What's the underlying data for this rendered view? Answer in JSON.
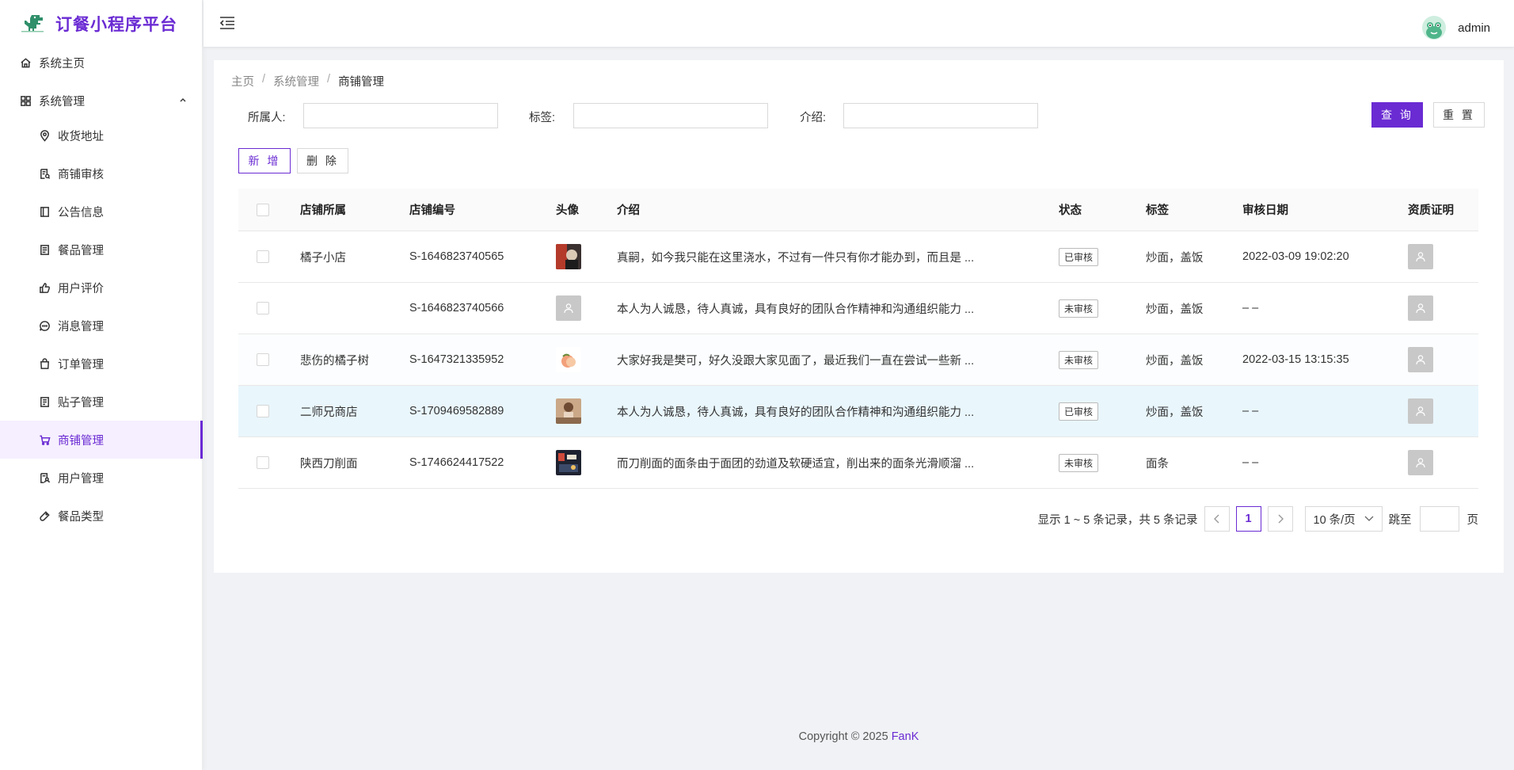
{
  "app": {
    "title": "订餐小程序平台"
  },
  "header": {
    "username": "admin"
  },
  "sidebar": {
    "items": [
      {
        "label": "系统主页",
        "icon": "home-icon"
      },
      {
        "label": "系统管理",
        "icon": "grid-icon"
      },
      {
        "label": "收货地址",
        "icon": "location-icon"
      },
      {
        "label": "商铺审核",
        "icon": "audit-icon"
      },
      {
        "label": "公告信息",
        "icon": "notice-icon"
      },
      {
        "label": "餐品管理",
        "icon": "dish-icon"
      },
      {
        "label": "用户评价",
        "icon": "thumb-up-icon"
      },
      {
        "label": "消息管理",
        "icon": "message-icon"
      },
      {
        "label": "订单管理",
        "icon": "bag-icon"
      },
      {
        "label": "贴子管理",
        "icon": "post-icon"
      },
      {
        "label": "商铺管理",
        "icon": "cart-icon"
      },
      {
        "label": "用户管理",
        "icon": "user-doc-icon"
      },
      {
        "label": "餐品类型",
        "icon": "tag-icon"
      }
    ],
    "active": "商铺管理"
  },
  "breadcrumb": [
    "主页",
    "系统管理",
    "商铺管理"
  ],
  "filters": {
    "owner_label": "所属人:",
    "owner_value": "",
    "tag_label": "标签:",
    "tag_value": "",
    "intro_label": "介绍:",
    "intro_value": ""
  },
  "buttons": {
    "query": "查 询",
    "reset": "重 置",
    "add": "新 增",
    "delete": "删 除"
  },
  "table": {
    "columns": [
      "店铺所属",
      "店铺编号",
      "头像",
      "介绍",
      "状态",
      "标签",
      "审核日期",
      "资质证明"
    ],
    "rows": [
      {
        "owner": "橘子小店",
        "id": "S-1646823740565",
        "intro": "真嗣，如今我只能在这里浇水，不过有一件只有你才能办到，而且是 ...",
        "status": "已审核",
        "tags": "炒面，盖饭",
        "date": "2022-03-09 19:02:20",
        "avatar": "photo-dark"
      },
      {
        "owner": "",
        "id": "S-1646823740566",
        "intro": "本人为人诚恳，待人真诚，具有良好的团队合作精神和沟通组织能力 ...",
        "status": "未审核",
        "tags": "炒面，盖饭",
        "date": "– –",
        "avatar": "placeholder"
      },
      {
        "owner": "悲伤的橘子树",
        "id": "S-1647321335952",
        "intro": "大家好我是樊可，好久没跟大家见面了，最近我们一直在尝试一些新 ...",
        "status": "未审核",
        "tags": "炒面，盖饭",
        "date": "2022-03-15 13:15:35",
        "avatar": "peach"
      },
      {
        "owner": "二师兄商店",
        "id": "S-1709469582889",
        "intro": "本人为人诚恳，待人真诚，具有良好的团队合作精神和沟通组织能力 ...",
        "status": "已审核",
        "tags": "炒面，盖饭",
        "date": "– –",
        "avatar": "photo-warm"
      },
      {
        "owner": "陕西刀削面",
        "id": "S-1746624417522",
        "intro": "而刀削面的面条由于面团的劲道及软硬适宜，削出来的面条光滑顺溜 ...",
        "status": "未审核",
        "tags": "面条",
        "date": "– –",
        "avatar": "photo-street"
      }
    ]
  },
  "pagination": {
    "summary": "显示 1 ~ 5 条记录，共 5 条记录",
    "current_page": "1",
    "page_size": "10 条/页",
    "jump_label": "跳至",
    "page_suffix": "页",
    "jump_value": ""
  },
  "footer": {
    "copyright": "Copyright © 2025 ",
    "author": "FanK"
  },
  "colors": {
    "accent": "#6a2bd3",
    "highlight_row": "#e9f6fc"
  }
}
